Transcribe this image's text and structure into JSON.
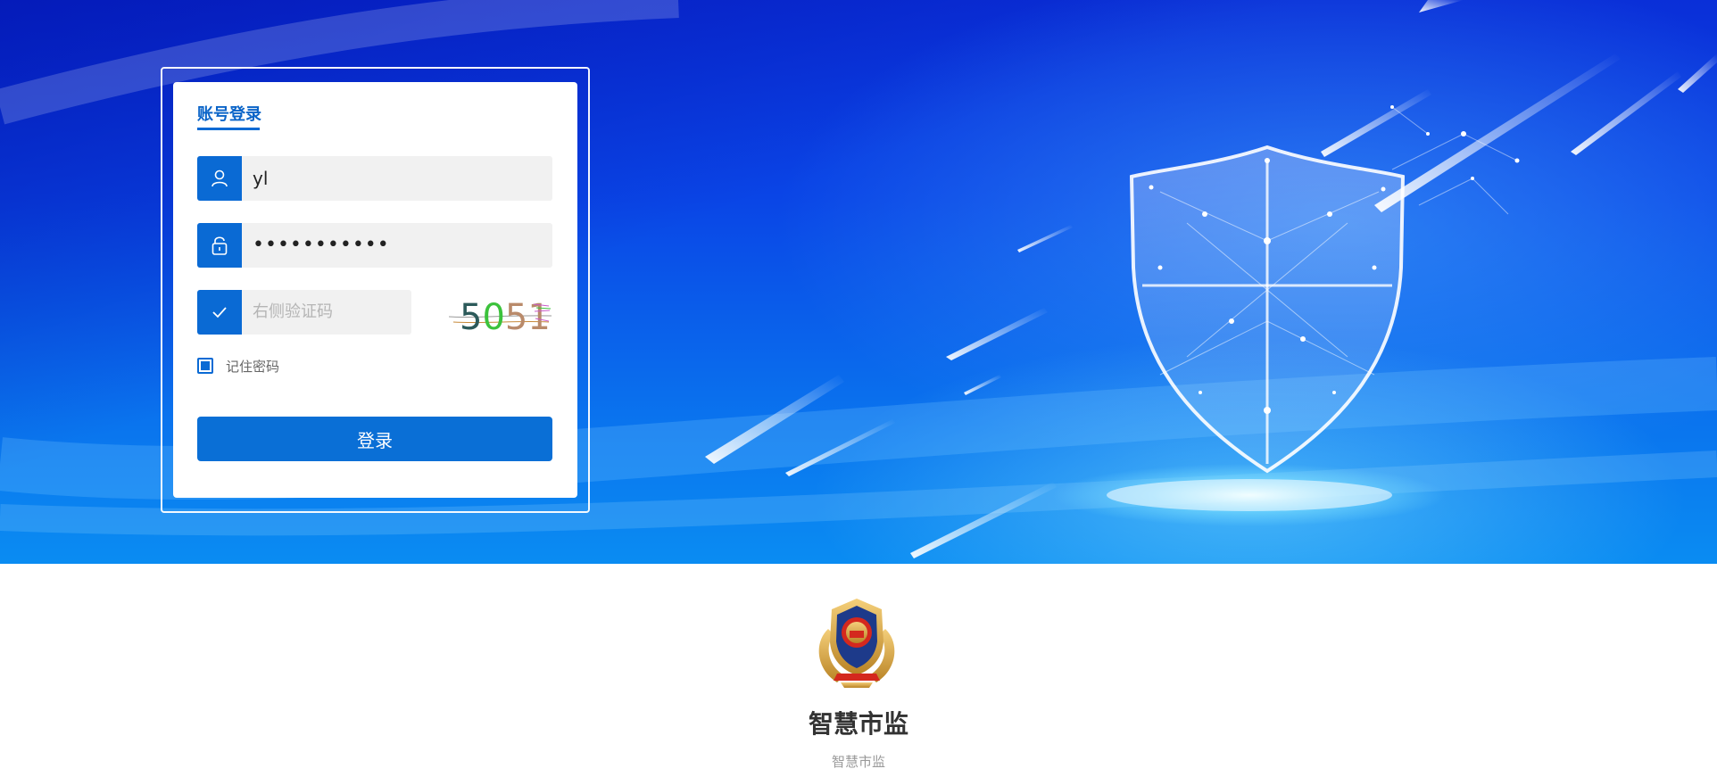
{
  "login": {
    "tab_label": "账号登录",
    "username_value": "yl",
    "password_masked": "•••••••••••",
    "captcha_placeholder": "右侧验证码",
    "captcha_image_text": "5051",
    "remember_label": "记住密码",
    "remember_checked": true,
    "submit_label": "登录"
  },
  "footer": {
    "brand_title": "智慧市监",
    "brand_subtitle": "智慧市监"
  },
  "icons": {
    "username": "user-icon",
    "password": "lock-icon",
    "captcha": "check-icon",
    "emblem": "market-regulation-emblem"
  },
  "colors": {
    "accent": "#0a6ad4",
    "hero_dark": "#0a2fd8",
    "hero_light": "#0a8cf2",
    "input_bg": "#f1f1f1"
  }
}
